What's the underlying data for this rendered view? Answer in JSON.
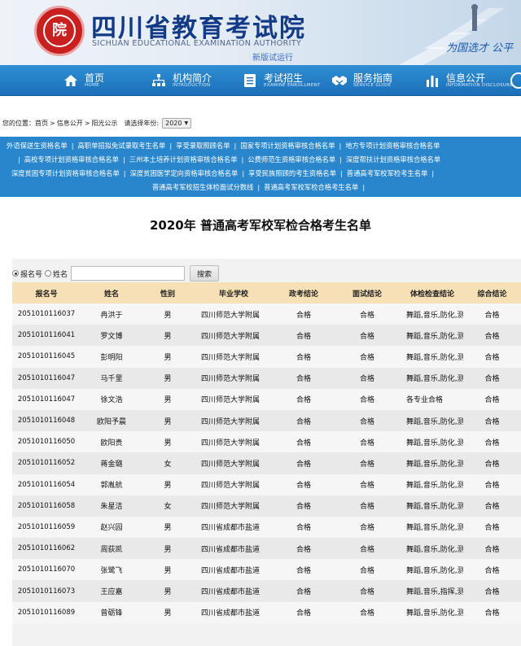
{
  "header": {
    "logo_text": "院",
    "title": "四川省教育考试院",
    "subtitle": "SICHUAN EDUCATIONAL EXAMINATION AUTHORITY",
    "note": "新版试运行",
    "slogan": "为国选才 公平"
  },
  "nav": [
    {
      "label": "首页",
      "en": "HOME",
      "icon": "home-icon"
    },
    {
      "label": "机构简介",
      "en": "INTRODUCTION",
      "icon": "org-chart-icon"
    },
    {
      "label": "考试招生",
      "en": "EXAMINE ENROLLMENT",
      "icon": "exam-list-icon"
    },
    {
      "label": "服务指南",
      "en": "SERVICE GUIDE",
      "icon": "handshake-icon"
    },
    {
      "label": "信息公开",
      "en": "INFORMATION DISCLOSURE",
      "icon": "info-bars-icon"
    }
  ],
  "breadcrumb": {
    "prefix": "您的位置：",
    "items": [
      "首页",
      "信息公开",
      "阳光公示"
    ],
    "year_prompt": "请选择年份:",
    "year_value": "2020"
  },
  "category_links": [
    [
      "外语保送生资格名单",
      "高职单招拟免试录取考生名单",
      "享受录取照顾名单",
      "国家专项计划资格审核合格名单",
      "地方专项计划资格审核合格名单"
    ],
    [
      "高校专项计划资格审核合格名单",
      "三州本土培养计划资格审核合格名单",
      "公费师范生资格审核合格名单",
      "深度帮扶计划资格审核合格名单"
    ],
    [
      "深度贫困专项计划资格审核合格名单",
      "深度贫困医学定向资格审核合格名单",
      "享受民族照顾的考生资格名单",
      "普通高考军校军检考生名单"
    ],
    [
      "普通高考军校招生体检面试分数线",
      "普通高考军校军检合格考生名单"
    ]
  ],
  "page_title": "2020年 普通高考军校军检合格考生名单",
  "search": {
    "option1": "报名号",
    "option2": "姓名",
    "input_value": "",
    "button": "搜索"
  },
  "table": {
    "headers": [
      "报名号",
      "姓名",
      "性别",
      "毕业学校",
      "政考结论",
      "面试结论",
      "体检检查结论",
      "综合结论"
    ],
    "rows": [
      [
        "2051010116037",
        "冉洪于",
        "男",
        "四川师范大学附属",
        "合格",
        "合格",
        "舞蹈,音乐,防化,测",
        "合格"
      ],
      [
        "2051010116041",
        "罗文博",
        "男",
        "四川师范大学附属",
        "合格",
        "合格",
        "舞蹈,音乐,防化,测",
        "合格"
      ],
      [
        "2051010116045",
        "彭明阳",
        "男",
        "四川师范大学附属",
        "合格",
        "合格",
        "舞蹈,音乐,防化,测",
        "合格"
      ],
      [
        "2051010116047",
        "马千里",
        "男",
        "四川师范大学附属",
        "合格",
        "合格",
        "舞蹈,音乐,防化,测",
        "合格"
      ],
      [
        "2051010116047",
        "徐文浩",
        "男",
        "四川师范大学附属",
        "合格",
        "合格",
        "各专业合格",
        "合格"
      ],
      [
        "2051010116048",
        "欧阳予晨",
        "男",
        "四川师范大学附属",
        "合格",
        "合格",
        "舞蹈,音乐,防化,测",
        "合格"
      ],
      [
        "2051010116050",
        "欧阳贵",
        "男",
        "四川师范大学附属",
        "合格",
        "合格",
        "舞蹈,音乐,防化,测",
        "合格"
      ],
      [
        "2051010116052",
        "蒋金璐",
        "女",
        "四川师范大学附属",
        "合格",
        "合格",
        "舞蹈,音乐,防化,测",
        "合格"
      ],
      [
        "2051010116054",
        "郭胤航",
        "男",
        "四川师范大学附属",
        "合格",
        "合格",
        "舞蹈,音乐,防化,测",
        "合格"
      ],
      [
        "2051010116058",
        "朱星洁",
        "女",
        "四川师范大学附属",
        "合格",
        "合格",
        "舞蹈,音乐,防化,测",
        "合格"
      ],
      [
        "2051010116059",
        "赵兴园",
        "男",
        "四川省成都市盐道",
        "合格",
        "合格",
        "舞蹈,音乐,防化,测",
        "合格"
      ],
      [
        "2051010116062",
        "周荻凯",
        "男",
        "四川省成都市盐道",
        "合格",
        "合格",
        "舞蹈,音乐,防化,测",
        "合格"
      ],
      [
        "2051010116070",
        "张鹭飞",
        "男",
        "四川省成都市盐道",
        "合格",
        "合格",
        "舞蹈,音乐,防化,测",
        "合格"
      ],
      [
        "2051010116073",
        "王应嘉",
        "男",
        "四川省成都市盐道",
        "合格",
        "合格",
        "舞蹈,音乐,指挥,测",
        "合格"
      ],
      [
        "2051010116089",
        "曾砺锋",
        "男",
        "四川省成都市盐道",
        "合格",
        "合格",
        "舞蹈,音乐,防化,测",
        "合格"
      ]
    ]
  },
  "colors": {
    "nav_blue": "#1b6fb8",
    "links_blue": "#2a86cc",
    "header_beige": "#f7e0b5",
    "title_navy": "#123a87",
    "logo_red": "#c8201f"
  }
}
